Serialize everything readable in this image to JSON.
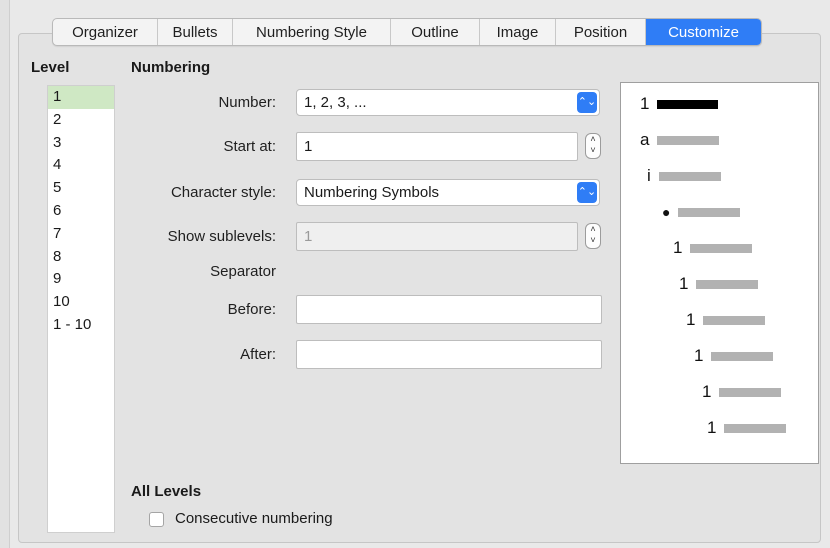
{
  "tabs": [
    {
      "label": "Organizer",
      "active": false
    },
    {
      "label": "Bullets",
      "active": false
    },
    {
      "label": "Numbering Style",
      "active": false
    },
    {
      "label": "Outline",
      "active": false
    },
    {
      "label": "Image",
      "active": false
    },
    {
      "label": "Position",
      "active": false
    },
    {
      "label": "Customize",
      "active": true
    }
  ],
  "level": {
    "title": "Level",
    "items": [
      "1",
      "2",
      "3",
      "4",
      "5",
      "6",
      "7",
      "8",
      "9",
      "10",
      "1 - 10"
    ],
    "selected": "1"
  },
  "numbering": {
    "title": "Numbering",
    "number_label": "Number:",
    "number_value": "1, 2, 3, ...",
    "start_label": "Start at:",
    "start_value": "1",
    "char_style_label": "Character style:",
    "char_style_value": "Numbering Symbols",
    "sublevels_label": "Show sublevels:",
    "sublevels_value": "1",
    "separator_label": "Separator",
    "before_label": "Before:",
    "before_value": "",
    "after_label": "After:",
    "after_value": ""
  },
  "preview": {
    "glyphs": [
      "1",
      "a",
      "i",
      "●",
      "1",
      "1",
      "1",
      "1",
      "1",
      "1"
    ]
  },
  "all_levels": {
    "title": "All Levels",
    "consecutive_label": "Consecutive numbering",
    "consecutive_checked": false
  },
  "colors": {
    "accent": "#2f7df6",
    "selected_row": "#cfe8c4"
  }
}
